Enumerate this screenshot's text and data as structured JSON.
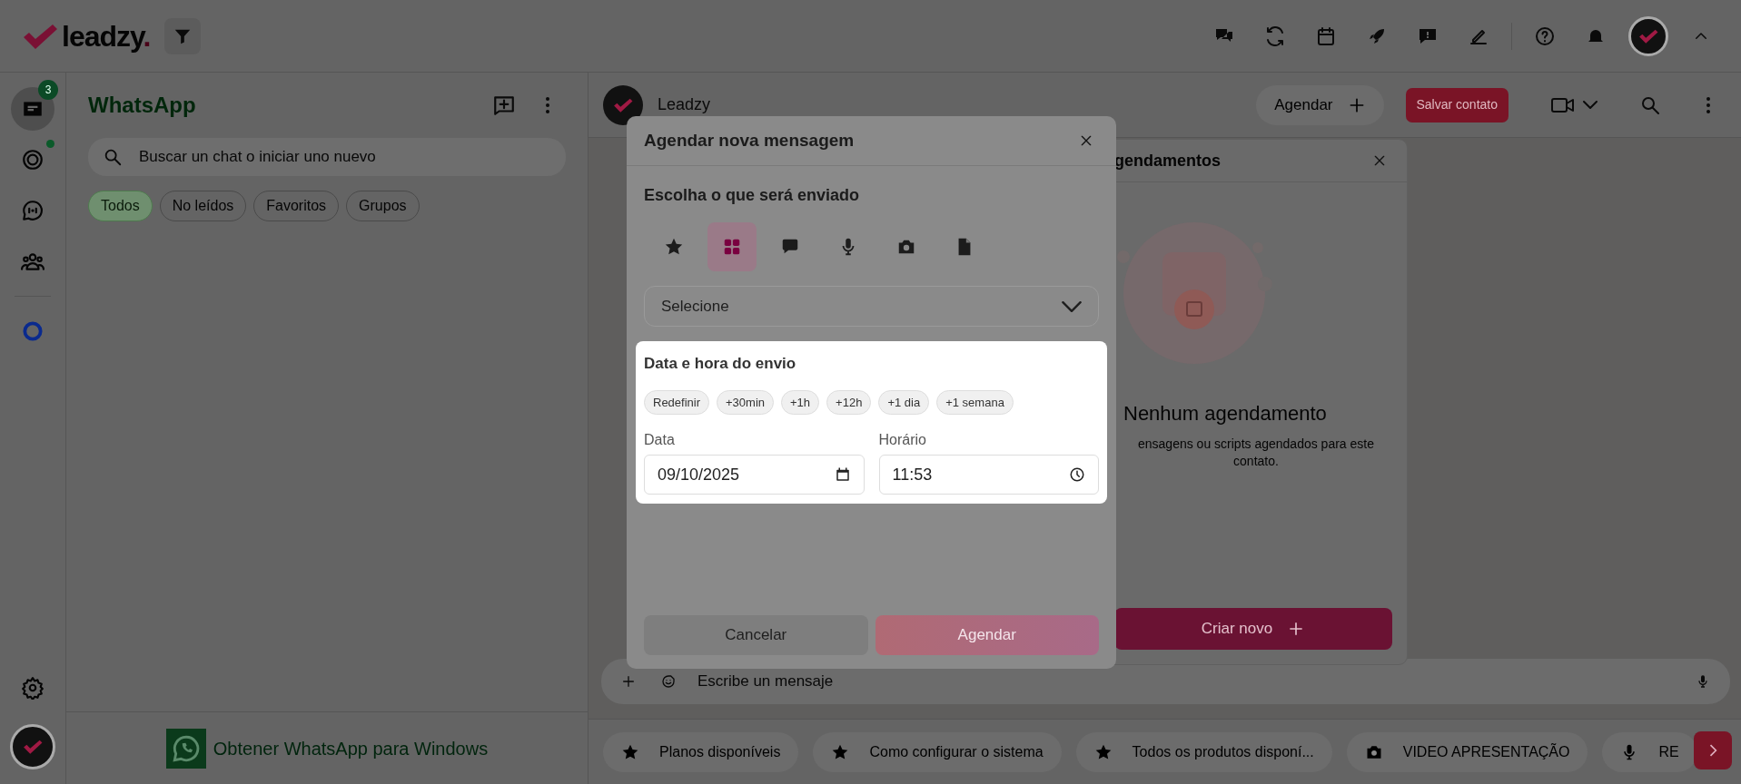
{
  "top_bar": {
    "logo": {
      "text": "leadzy",
      "dot": "."
    },
    "tools": [
      {
        "kind": "chats"
      },
      {
        "kind": "sync"
      },
      {
        "kind": "calendar"
      },
      {
        "kind": "rocket"
      },
      {
        "kind": "message"
      },
      {
        "kind": "pen"
      },
      {
        "kind": "help"
      },
      {
        "kind": "bell"
      }
    ]
  },
  "rail": {
    "items": [
      {
        "kind": "inbox",
        "selected": true,
        "badge": "3",
        "dot": false
      },
      {
        "kind": "status",
        "selected": false,
        "dot": true
      },
      {
        "kind": "channels",
        "selected": false,
        "dot": false
      },
      {
        "kind": "communities",
        "selected": false,
        "dot": false
      },
      {
        "kind": "ring",
        "selected": false,
        "dot": false
      }
    ]
  },
  "chat_list": {
    "title": "WhatsApp",
    "search": {
      "placeholder": "Buscar un chat o iniciar uno nuevo"
    },
    "filters": [
      {
        "label": "Todos",
        "selected": true
      },
      {
        "label": "No leídos",
        "selected": false
      },
      {
        "label": "Favoritos",
        "selected": false
      },
      {
        "label": "Grupos",
        "selected": false
      }
    ],
    "footer": "Obtener WhatsApp para Windows"
  },
  "chat": {
    "contact": "Leadzy",
    "schedule_button": "Agendar",
    "save_button": "Salvar contato",
    "composer": {
      "placeholder": "Escribe un mensaje"
    },
    "quick_replies": [
      {
        "kind": "star",
        "label": "Planos disponíveis"
      },
      {
        "kind": "star",
        "label": "Como configurar o sistema"
      },
      {
        "kind": "star",
        "label": "Todos os produtos disponí..."
      },
      {
        "kind": "camera",
        "label": "VIDEO APRESENTAÇÃO"
      },
      {
        "kind": "mic",
        "label": "RE"
      }
    ]
  },
  "schedules_panel": {
    "title": "gendamentos",
    "empty_title": "Nenhum agendamento",
    "empty_text": "ensagens ou scripts agendados para este contato.",
    "create_button": "Criar novo"
  },
  "modal": {
    "title": "Agendar nova mensagem",
    "choose_title": "Escolha o que será enviado",
    "types": [
      {
        "kind": "star",
        "selected": false
      },
      {
        "kind": "grid",
        "selected": true
      },
      {
        "kind": "chat",
        "selected": false
      },
      {
        "kind": "mic",
        "selected": false
      },
      {
        "kind": "camera",
        "selected": false
      },
      {
        "kind": "file",
        "selected": false
      }
    ],
    "select": {
      "placeholder": "Selecione"
    },
    "datetime": {
      "title": "Data e hora do envio",
      "shortcuts": [
        "Redefinir",
        "+30min",
        "+1h",
        "+12h",
        "+1 dia",
        "+1 semana"
      ],
      "date_label": "Data",
      "date_value": "09/10/2025",
      "time_label": "Horário",
      "time_value": "11:53"
    },
    "cancel_button": "Cancelar",
    "submit_button": {
      "label": "Agendar",
      "disabled": true
    }
  }
}
